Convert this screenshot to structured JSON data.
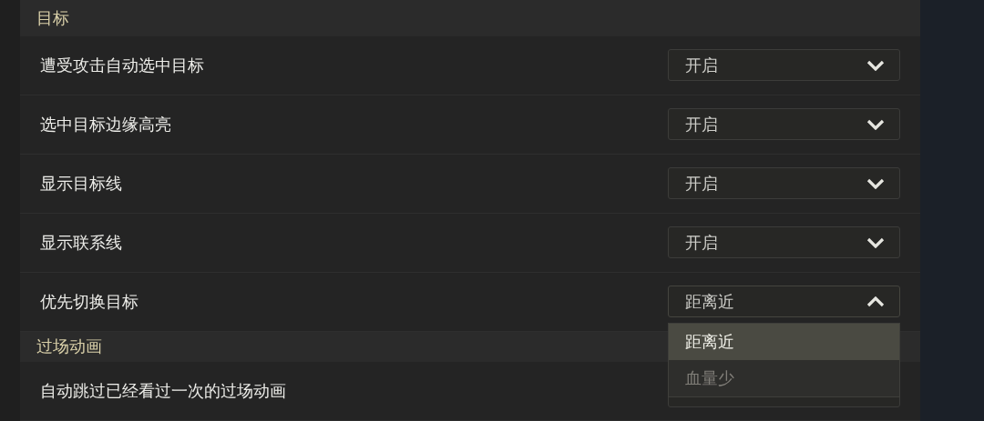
{
  "sections": [
    {
      "title": "目标",
      "settings": [
        {
          "label": "遭受攻击自动选中目标",
          "value": "开启",
          "expanded": false
        },
        {
          "label": "选中目标边缘高亮",
          "value": "开启",
          "expanded": false
        },
        {
          "label": "显示目标线",
          "value": "开启",
          "expanded": false
        },
        {
          "label": "显示联系线",
          "value": "开启",
          "expanded": false
        },
        {
          "label": "优先切换目标",
          "value": "距离近",
          "expanded": true,
          "options": [
            {
              "label": "距离近",
              "selected": true
            },
            {
              "label": "血量少",
              "selected": false
            }
          ]
        }
      ]
    },
    {
      "title": "过场动画",
      "settings": [
        {
          "label": "自动跳过已经看过一次的过场动画"
        }
      ]
    }
  ]
}
